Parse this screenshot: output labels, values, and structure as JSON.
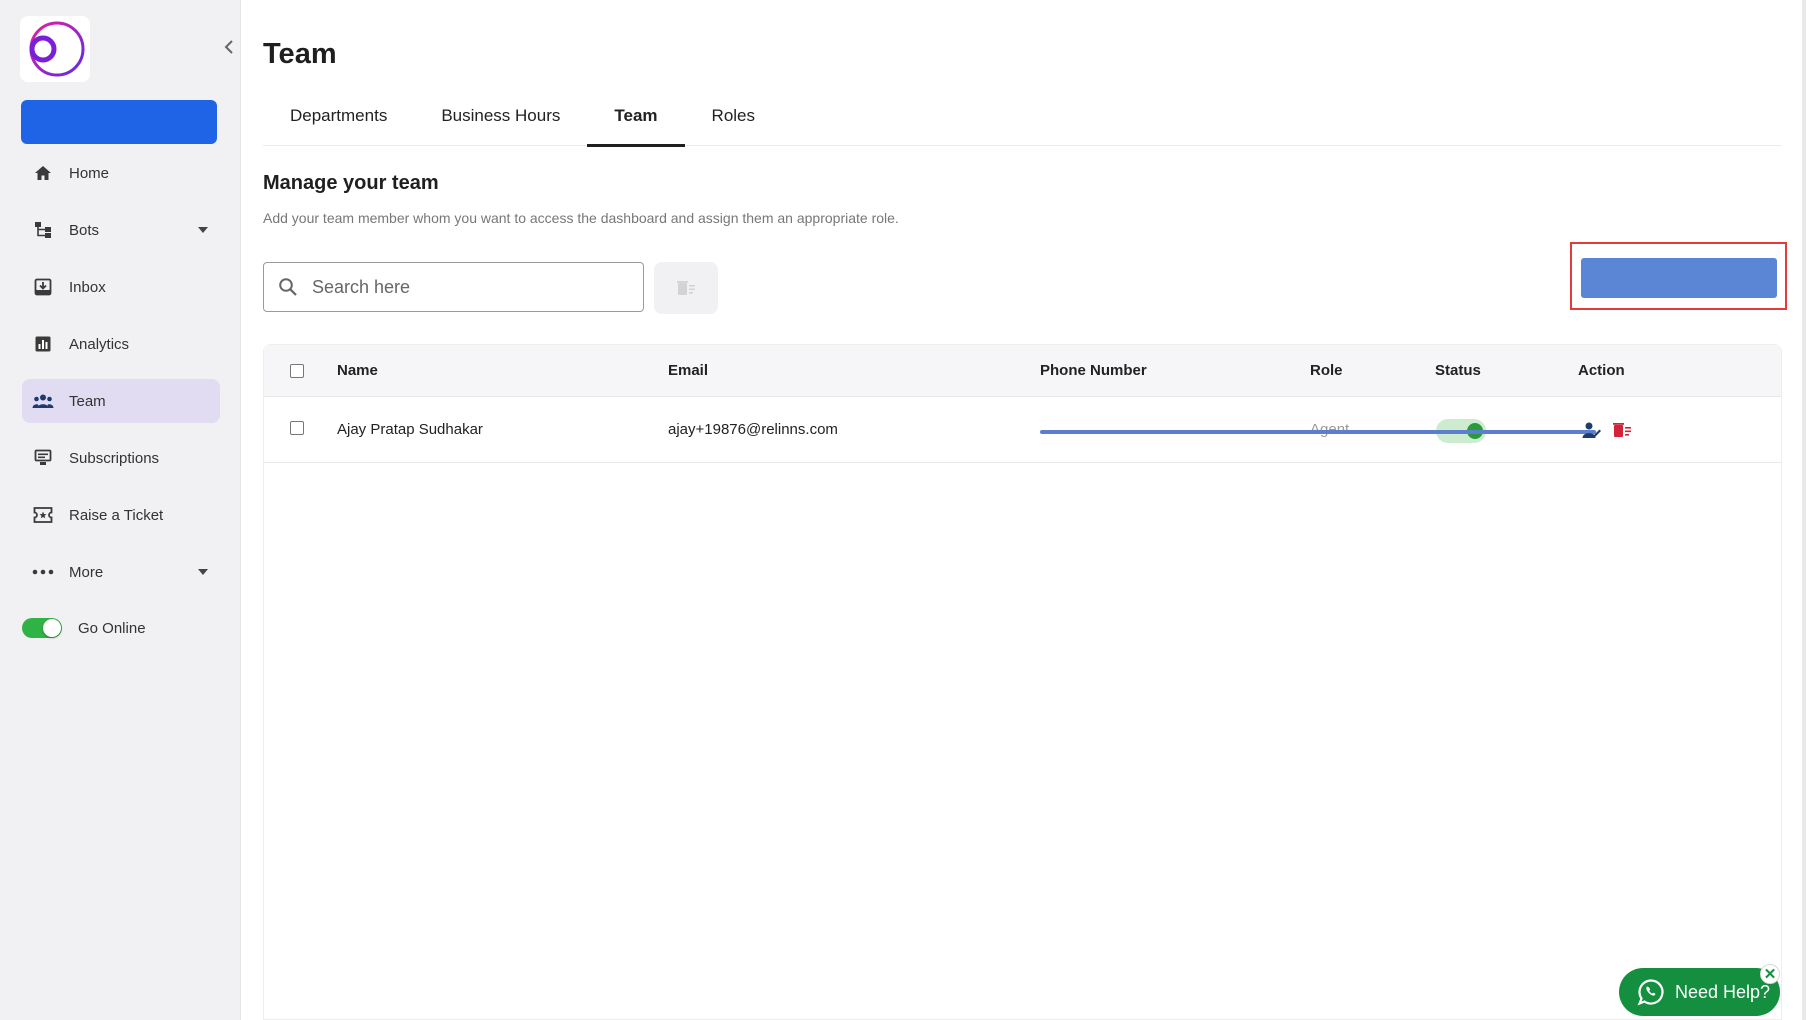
{
  "colors": {
    "primary": "#1f63e6",
    "active_nav_bg": "#e2dcf3",
    "toggle_on": "#2fb344",
    "highlight": "#e23b3b",
    "whatsapp_green": "#138f3f",
    "delete_red": "#d2233a"
  },
  "sidebar": {
    "primary_button_label": "",
    "items": [
      {
        "label": "Home",
        "icon": "home-icon"
      },
      {
        "label": "Bots",
        "icon": "bots-icon",
        "has_caret": true
      },
      {
        "label": "Inbox",
        "icon": "inbox-icon"
      },
      {
        "label": "Analytics",
        "icon": "analytics-icon"
      },
      {
        "label": "Team",
        "icon": "team-icon",
        "active": true
      },
      {
        "label": "Subscriptions",
        "icon": "subscriptions-icon"
      },
      {
        "label": "Raise a Ticket",
        "icon": "ticket-icon"
      },
      {
        "label": "More",
        "icon": "more-icon",
        "has_caret": true
      }
    ],
    "go_online_label": "Go Online",
    "go_online": true
  },
  "page": {
    "title": "Team",
    "tabs": [
      {
        "label": "Departments"
      },
      {
        "label": "Business Hours"
      },
      {
        "label": "Team",
        "active": true
      },
      {
        "label": "Roles"
      }
    ],
    "section_title": "Manage your team",
    "section_description": "Add your team member whom you want to access the dashboard and assign them an appropriate role.",
    "search_placeholder": "Search here",
    "add_button_label": ""
  },
  "table": {
    "headers": {
      "name": "Name",
      "email": "Email",
      "phone": "Phone Number",
      "role": "Role",
      "status": "Status",
      "action": "Action"
    },
    "rows": [
      {
        "name": "Ajay Pratap Sudhakar",
        "email": "ajay+19876@relinns.com",
        "phone": "",
        "role": "Agent",
        "status_active": true
      }
    ]
  },
  "help_widget": {
    "label": "Need Help?"
  }
}
